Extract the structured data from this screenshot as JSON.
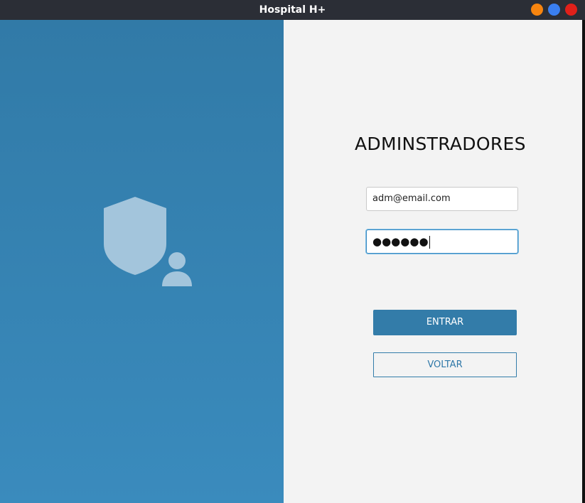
{
  "window": {
    "title": "Hospital H+",
    "controls": [
      {
        "name": "minimize",
        "color": "#f7850f"
      },
      {
        "name": "maximize",
        "color": "#3a7ff0"
      },
      {
        "name": "close",
        "color": "#e0201a"
      }
    ]
  },
  "left_panel": {
    "icon": "admin-shield-user-icon",
    "gradient_top": "#317aa7",
    "gradient_bottom": "#3a8bbd",
    "icon_color": "#a3c5dc"
  },
  "login": {
    "heading": "ADMINSTRADORES",
    "email_value": "adm@email.com",
    "password_value": "●●●●●●",
    "enter_label": "ENTRAR",
    "back_label": "VOLTAR"
  },
  "colors": {
    "accent": "#337ca9",
    "background": "#f3f3f3"
  }
}
